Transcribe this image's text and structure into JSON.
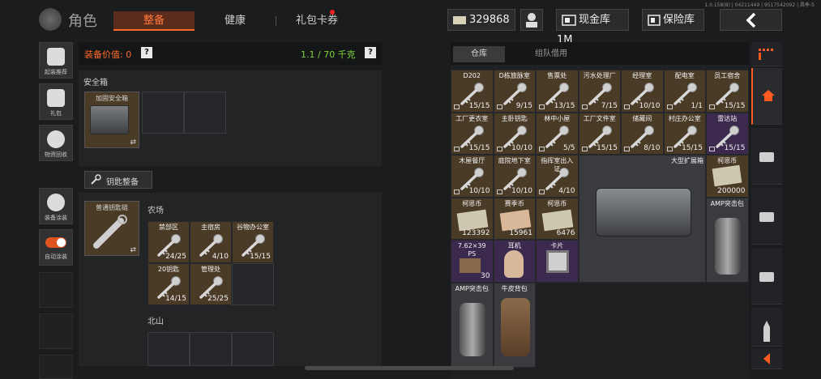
{
  "version": "1.0.158(8) | 04211449 | 9517542092 | 昌季-5",
  "header": {
    "title": "角色",
    "tabs": [
      {
        "label": "整备",
        "active": true
      },
      {
        "label": "健康",
        "active": false
      },
      {
        "label": "礼包卡券",
        "active": false
      }
    ],
    "currency": "329868",
    "cash_button": "现金库 1M",
    "vault_button": "保险库",
    "back_icon": "chevron-left-icon"
  },
  "sidebar": [
    {
      "label": "起装推荐",
      "icon": "helmet-gear-icon"
    },
    {
      "label": "礼包",
      "icon": "gift-icon"
    },
    {
      "label": "物资回收",
      "icon": "recycle-icon"
    },
    {
      "label": "装备涂装",
      "icon": "paint-helmet-icon"
    },
    {
      "label": "自动涂装",
      "icon": "toggle-icon",
      "toggle_on": true
    }
  ],
  "equipment": {
    "value_label": "装备价值: 0",
    "weight": "1.1 / 70 千克",
    "help": "?"
  },
  "safe_box": {
    "title": "安全箱",
    "item_name": "加固安全箱",
    "swap": "⇄"
  },
  "key_section": {
    "button": "钥匙整备",
    "keychain_name": "普通钥匙链",
    "swap": "⇄",
    "farm_title": "农场",
    "farm_keys": [
      {
        "name": "禁部区",
        "count": "24/25"
      },
      {
        "name": "主宿房",
        "count": "4/10"
      },
      {
        "name": "谷物办公室",
        "count": "15/15"
      },
      {
        "name": "20钥匙",
        "count": "14/15"
      },
      {
        "name": "管理处",
        "count": "25/25"
      }
    ],
    "north_title": "北山"
  },
  "storage": {
    "tabs": [
      {
        "label": "仓库",
        "active": true
      },
      {
        "label": "组队借用",
        "active": false
      }
    ],
    "key_rows": [
      [
        {
          "name": "D202",
          "count": "15/15"
        },
        {
          "name": "D栋旅脉室",
          "count": "9/15"
        },
        {
          "name": "售票处",
          "count": "13/15"
        },
        {
          "name": "污水处理厂",
          "count": "7/15"
        },
        {
          "name": "经理室",
          "count": "10/10"
        },
        {
          "name": "配电室",
          "count": "1/1"
        },
        {
          "name": "员工宿舍",
          "count": "15/15"
        }
      ],
      [
        {
          "name": "工厂更衣室",
          "count": "15/15"
        },
        {
          "name": "主卧钥匙",
          "count": "10/10"
        },
        {
          "name": "林中小屋",
          "count": "5/5"
        },
        {
          "name": "工厂文件室",
          "count": "15/15"
        },
        {
          "name": "储藏间",
          "count": "8/10"
        },
        {
          "name": "村庄办公室",
          "count": "15/15"
        },
        {
          "name": "雷达站",
          "count": "15/15",
          "rare": true
        }
      ],
      [
        {
          "name": "木屋餐厅",
          "count": "10/10"
        },
        {
          "name": "庭院地下室",
          "count": "10/10"
        },
        {
          "name": "指挥室出入证",
          "count": "4/10"
        }
      ]
    ],
    "big_case": "大型扩展箱",
    "money_items": [
      {
        "name": "柯恩币",
        "count": "200000"
      },
      {
        "name": "柯恩币",
        "count": "123392"
      },
      {
        "name": "赛季币",
        "count": "15961"
      },
      {
        "name": "柯恩币",
        "count": "6476"
      }
    ],
    "amp_grenade_1": "AMP突击包",
    "amp_grenade_2": "AMP突击包",
    "ammo": {
      "name": "7.62×39 PS",
      "count": "30"
    },
    "earbud": "耳机",
    "card": "卡片",
    "backpack": "牛皮背包"
  },
  "right_rail": [
    {
      "icon": "menu-grid-icon"
    },
    {
      "icon": "home-icon",
      "active": true
    },
    {
      "icon": "container-icon"
    },
    {
      "icon": "container-icon"
    },
    {
      "icon": "container-icon"
    },
    {
      "icon": "ammo-icon"
    },
    {
      "icon": "chevron-left-icon"
    }
  ]
}
